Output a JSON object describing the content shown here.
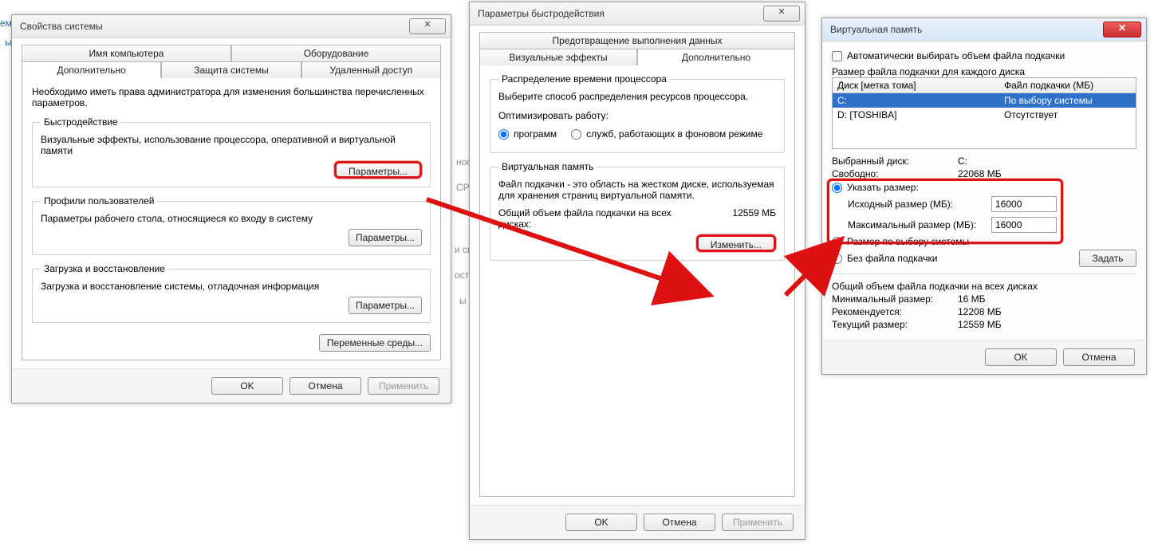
{
  "under": {
    "t1": "ем",
    "t2": "ы",
    "t3": "нос",
    "t4": "CPU",
    "t5": "и  сы",
    "t6": "ост",
    "t7": "ы"
  },
  "win1": {
    "title": "Свойства системы",
    "close_glyph": "✕",
    "tabs": {
      "top1": "Имя компьютера",
      "top2": "Оборудование",
      "bot1": "Дополнительно",
      "bot2": "Защита системы",
      "bot3": "Удаленный доступ"
    },
    "intro": "Необходимо иметь права администратора для изменения большинства перечисленных параметров.",
    "perf": {
      "legend": "Быстродействие",
      "text": "Визуальные эффекты, использование процессора, оперативной и виртуальной памяти",
      "btn": "Параметры..."
    },
    "profiles": {
      "legend": "Профили пользователей",
      "text": "Параметры рабочего стола, относящиеся ко входу в систему",
      "btn": "Параметры..."
    },
    "startup": {
      "legend": "Загрузка и восстановление",
      "text": "Загрузка и восстановление системы, отладочная информация",
      "btn": "Параметры..."
    },
    "env_btn": "Переменные среды...",
    "ok": "OK",
    "cancel": "Отмена",
    "apply": "Применить"
  },
  "win2": {
    "title": "Параметры быстродействия",
    "close_glyph": "✕",
    "tabs": {
      "top": "Предотвращение выполнения данных",
      "bot1": "Визуальные эффекты",
      "bot2": "Дополнительно"
    },
    "cpu": {
      "legend": "Распределение времени процессора",
      "text": "Выберите способ распределения ресурсов процессора.",
      "opt_label": "Оптимизировать работу:",
      "r1": "программ",
      "r2": "служб, работающих в фоновом режиме"
    },
    "vm": {
      "legend": "Виртуальная память",
      "text": "Файл подкачки - это область на жестком диске, используемая для хранения страниц виртуальной памяти.",
      "total_label": "Общий объем файла подкачки на всех дисках:",
      "total_val": "12559 МБ",
      "btn": "Изменить..."
    },
    "ok": "OK",
    "cancel": "Отмена",
    "apply": "Применить"
  },
  "win3": {
    "title": "Виртуальная память",
    "close_glyph": "✕",
    "auto_check": "Автоматически выбирать объем файла подкачки",
    "list_caption": "Размер файла подкачки для каждого диска",
    "col1": "Диск [метка тома]",
    "col2": "Файл подкачки (МБ)",
    "row1_drive": "C:",
    "row1_val": "По выбору системы",
    "row2_drive": "D:   [TOSHIBA]",
    "row2_val": "Отсутствует",
    "sel_drive_label": "Выбранный диск:",
    "sel_drive_val": "C:",
    "free_label": "Свободно:",
    "free_val": "22068 МБ",
    "r_custom": "Указать размер:",
    "initial_label": "Исходный размер (МБ):",
    "initial_val": "16000",
    "max_label": "Максимальный размер (МБ):",
    "max_val": "16000",
    "r_system": "Размер по выбору системы",
    "r_none": "Без файла подкачки",
    "set_btn": "Задать",
    "totals_caption": "Общий объем файла подкачки на всех дисках",
    "min_label": "Минимальный размер:",
    "min_val": "16 МБ",
    "rec_label": "Рекомендуется:",
    "rec_val": "12208 МБ",
    "cur_label": "Текущий размер:",
    "cur_val": "12559 МБ",
    "ok": "OK",
    "cancel": "Отмена"
  }
}
